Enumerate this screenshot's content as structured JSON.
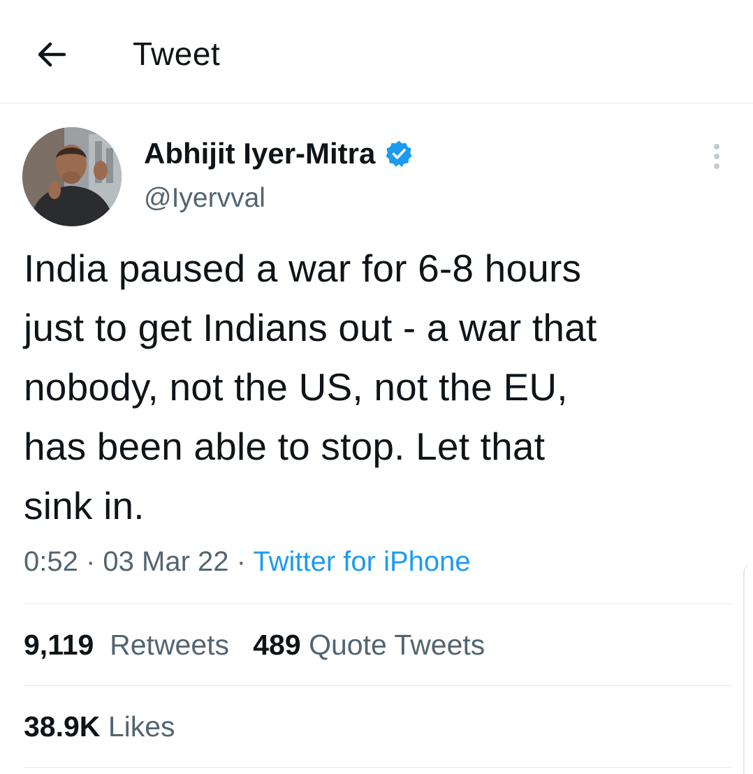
{
  "header": {
    "back_icon": "arrow-left-icon",
    "title": "Tweet"
  },
  "author": {
    "name": "Abhijit Iyer-Mitra",
    "handle": "@Iyervval",
    "verified_icon": "verified-badge-icon",
    "verified_color": "#1d9bf0"
  },
  "more_icon": "more-vertical-icon",
  "tweet": {
    "text_lines": [
      "India paused a war for 6-8 hours",
      "just to get Indians out - a war that",
      "nobody, not the US, not the EU,",
      "has been able to stop. Let that",
      "sink in."
    ],
    "time": "0:52",
    "date": "03 Mar 22",
    "source": "Twitter for iPhone"
  },
  "stats": {
    "retweets_count": "9,119",
    "retweets_label": "Retweets",
    "quotes_count": "489",
    "quotes_label": "Quote Tweets",
    "likes_count": "38.9K",
    "likes_label": "Likes"
  },
  "colors": {
    "text": "#0f1419",
    "secondary": "#536471",
    "link": "#1d9bf0",
    "divider": "#e3e6e9"
  }
}
